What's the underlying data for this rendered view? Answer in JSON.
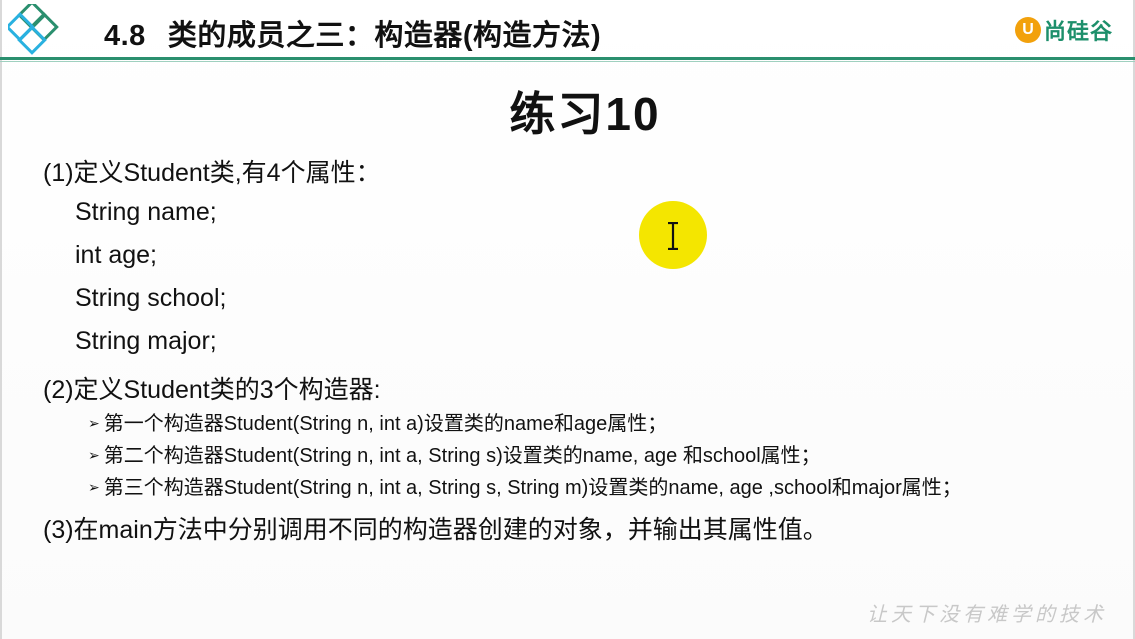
{
  "header": {
    "section_number": "4.8",
    "section_title": "类的成员之三：构造器(构造方法)",
    "brand_mark": "U",
    "brand_name": "尚硅谷"
  },
  "slide": {
    "title": "练习10",
    "item1": "(1)定义Student类,有4个属性：",
    "fields": [
      "String name;",
      "int age;",
      "String school;",
      "String major;"
    ],
    "item2": "(2)定义Student类的3个构造器:",
    "bullets": [
      "第一个构造器Student(String n, int a)设置类的name和age属性；",
      "第二个构造器Student(String n, int a, String s)设置类的name, age 和school属性；",
      "第三个构造器Student(String n, int a, String s, String m)设置类的name, age ,school和major属性；"
    ],
    "item3": "(3)在main方法中分别调用不同的构造器创建的对象，并输出其属性值。",
    "bullet_marker": "➢"
  },
  "footer": {
    "watermark": "让天下没有难学的技术"
  },
  "colors": {
    "accent_green": "#2a8f6e",
    "brand_orange": "#f2a10c",
    "cursor_highlight": "#f4e600"
  },
  "icons": {
    "logo": "diamond-logo-icon",
    "cursor": "text-cursor-icon"
  }
}
